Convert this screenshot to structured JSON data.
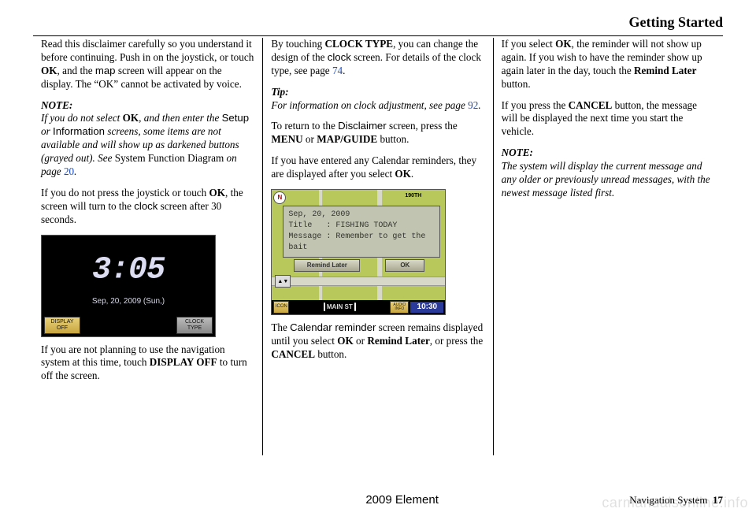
{
  "header": {
    "title": "Getting Started"
  },
  "col1": {
    "p1a": "Read this disclaimer carefully so you understand it before continuing. Push in on the joystick, or touch ",
    "p1b": "OK",
    "p1c": ", and the ",
    "p1d": "map",
    "p1e": " screen will appear on the display. The “OK” cannot be activated by voice.",
    "noteLabel": "NOTE:",
    "p2a": "If you do not select ",
    "p2b": "OK",
    "p2c": ", and then enter the ",
    "p2d": "Setup",
    "p2e": " or ",
    "p2f": "Information",
    "p2g": " screens, some items are not available and will show up as darkened buttons (grayed out). See ",
    "p2h": "System Function Diagram",
    "p2i": " on page ",
    "p2j": "20",
    "p2k": ".",
    "p3a": "If you do not press the joystick or touch ",
    "p3b": "OK",
    "p3c": ", the screen will turn to the ",
    "p3d": "clock",
    "p3e": " screen after 30 seconds.",
    "screen": {
      "time": "3:05",
      "date": "Sep, 20, 2009 (Sun,)",
      "btnLeft": "DISPLAY\nOFF",
      "btnRight": "CLOCK\nTYPE"
    },
    "p4a": "If you are not planning to use the navigation system at this time, touch ",
    "p4b": "DISPLAY OFF",
    "p4c": " to turn off the screen."
  },
  "col2": {
    "p1a": "By touching ",
    "p1b": "CLOCK TYPE",
    "p1c": ", you can change the design of the ",
    "p1d": "clock",
    "p1e": " screen. For details of the clock type, see page ",
    "p1f": "74",
    "p1g": ".",
    "tipLabel": "Tip:",
    "p2a": "For information on clock adjustment, see page ",
    "p2b": "92",
    "p2c": ".",
    "p3a": "To return to the ",
    "p3b": "Disclaimer",
    "p3c": " screen, press the ",
    "p3d": "MENU",
    "p3e": " or ",
    "p3f": "MAP/GUIDE",
    "p3g": " button.",
    "p4a": "If you have entered any Calendar reminders, they are displayed after you select ",
    "p4b": "OK",
    "p4c": ".",
    "map": {
      "north": "N",
      "road190": "190TH",
      "popupDate": "Sep, 20, 2009",
      "popupTitleLbl": "Title",
      "popupTitleVal": ": FISHING TODAY",
      "popupMsgLbl": "Message",
      "popupMsgVal": ": Remember to get the bait",
      "btnRemind": "Remind Later",
      "btnOk": "OK",
      "iconLabel": "ICON",
      "mainStreet": "MAIN ST",
      "audioLabel": "AUDIO INFO",
      "time": "10:30",
      "scale": "▲▼"
    },
    "p5a": "The ",
    "p5b": "Calendar reminder",
    "p5c": " screen remains displayed until you select ",
    "p5d": "OK",
    "p5e": " or ",
    "p5f": "Remind Later",
    "p5g": ", or press the ",
    "p5h": "CANCEL",
    "p5i": " button."
  },
  "col3": {
    "p1a": "If you select ",
    "p1b": "OK",
    "p1c": ", the reminder will not show up again. If you wish to have the reminder show up again later in the day, touch the ",
    "p1d": "Remind Later",
    "p1e": " button.",
    "p2a": "If you press the ",
    "p2b": "CANCEL",
    "p2c": " button, the message will be displayed the next time you start the vehicle.",
    "noteLabel": "NOTE:",
    "p3": "The system will display the current message and any older or previously unread messages, with the newest message listed first."
  },
  "footer": {
    "center": "2009  Element",
    "rightLabel": "Navigation System",
    "pageNum": "17"
  },
  "watermark": "carmanualsonline.info"
}
